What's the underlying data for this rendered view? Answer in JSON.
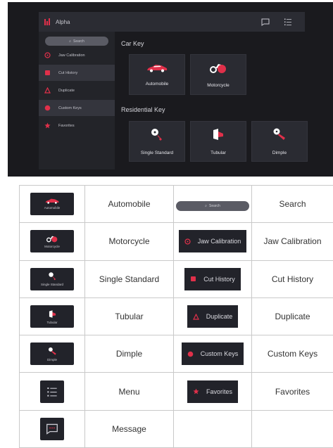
{
  "app": {
    "title": "Alpha",
    "search_label": "Search",
    "sidebar_items": [
      {
        "label": "Jaw Calibration",
        "icon": "jaw-calibration-icon"
      },
      {
        "label": "Cut History",
        "icon": "cut-history-icon",
        "active": true
      },
      {
        "label": "Duplicate",
        "icon": "duplicate-icon"
      },
      {
        "label": "Custom Keys",
        "icon": "custom-keys-icon",
        "active": true
      },
      {
        "label": "Favorites",
        "icon": "favorites-icon"
      }
    ],
    "sections": [
      {
        "title": "Car Key",
        "items": [
          {
            "label": "Automobile",
            "icon": "automobile-icon"
          },
          {
            "label": "Motorcycle",
            "icon": "motorcycle-icon"
          }
        ]
      },
      {
        "title": "Residential Key",
        "items": [
          {
            "label": "Single Standard",
            "icon": "single-standard-key-icon"
          },
          {
            "label": "Tubular",
            "icon": "tubular-key-icon"
          },
          {
            "label": "Dimple",
            "icon": "dimple-key-icon"
          }
        ]
      }
    ]
  },
  "legend": {
    "rows": [
      {
        "left_label": "Automobile",
        "left_caption": "Automobile",
        "right_label": "Search",
        "right_caption": "Search"
      },
      {
        "left_label": "Motorcycle",
        "left_caption": "Motorcycle",
        "right_label": "Jaw Calibration",
        "right_caption": "Jaw Calibration"
      },
      {
        "left_label": "Single Standard",
        "left_caption": "Single Standard",
        "right_label": "Cut History",
        "right_caption": "Cut History"
      },
      {
        "left_label": "Tubular",
        "left_caption": "Tubular",
        "right_label": "Duplicate",
        "right_caption": "Duplicate"
      },
      {
        "left_label": "Dimple",
        "left_caption": "Dimple",
        "right_label": "Custom Keys",
        "right_caption": "Custom Keys"
      },
      {
        "left_label": "Menu",
        "right_label": "Favorites",
        "right_caption": "Favorites"
      },
      {
        "left_label": "Message"
      }
    ]
  },
  "colors": {
    "accent": "#e0304a",
    "panel": "#2a2b32",
    "background": "#1a1a1e"
  }
}
